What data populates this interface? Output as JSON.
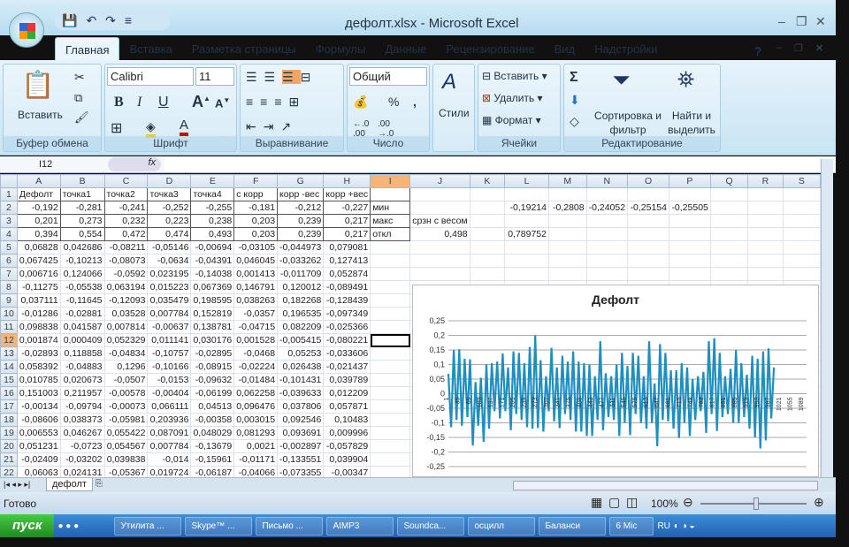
{
  "window": {
    "title": "дефолт.xlsx - Microsoft Excel"
  },
  "tabs": [
    "Главная",
    "Вставка",
    "Разметка страницы",
    "Формулы",
    "Данные",
    "Рецензирование",
    "Вид",
    "Надстройки"
  ],
  "ribbon": {
    "clipboard": {
      "label": "Буфер обмена",
      "paste": "Вставить"
    },
    "font": {
      "label": "Шрифт",
      "name": "Calibri",
      "size": "11",
      "bold": "B",
      "italic": "I",
      "underline": "U"
    },
    "alignment": {
      "label": "Выравнивание"
    },
    "number": {
      "label": "Число",
      "format": "Общий",
      "percent": "%"
    },
    "styles": {
      "label": "Стили"
    },
    "cells": {
      "label": "Ячейки",
      "insert": "Вставить",
      "delete": "Удалить",
      "format": "Формат"
    },
    "editing": {
      "label": "Редактирование",
      "sort": "Сортировка и фильтр",
      "find": "Найти и выделить"
    }
  },
  "formula_bar": {
    "name_box": "I12",
    "fx": "fx",
    "value": ""
  },
  "grid": {
    "columns": [
      "A",
      "B",
      "C",
      "D",
      "E",
      "F",
      "G",
      "H",
      "I",
      "J",
      "K",
      "L",
      "M",
      "N",
      "O",
      "P",
      "Q",
      "R",
      "S"
    ],
    "selected_cell": "I12",
    "rows": [
      [
        "Дефолт",
        "точка1",
        "точка2",
        "точка3",
        "точка4",
        "с корр",
        "корр -вес",
        "корр +вес",
        "",
        "",
        "",
        "",
        "",
        "",
        "",
        "",
        "",
        "",
        ""
      ],
      [
        "-0,192",
        "-0,281",
        "-0,241",
        "-0,252",
        "-0,255",
        "-0,181",
        "-0,212",
        "-0,227",
        "мин",
        "",
        "",
        "-0,19214",
        "-0,2808",
        "-0,24052",
        "-0,25154",
        "-0,25505",
        "",
        "",
        ""
      ],
      [
        "0,201",
        "0,273",
        "0,232",
        "0,223",
        "0,238",
        "0,203",
        "0,239",
        "0,217",
        "макс",
        "срзн с весом",
        "",
        "",
        "",
        "",
        "",
        "",
        "",
        "",
        ""
      ],
      [
        "0,394",
        "0,554",
        "0,472",
        "0,474",
        "0,493",
        "0,203",
        "0,239",
        "0,217",
        "откл",
        "0,498",
        "",
        "0,789752",
        "",
        "",
        "",
        "",
        "",
        "",
        ""
      ],
      [
        "0,06828",
        "0,042686",
        "-0,08211",
        "-0,05146",
        "-0,00694",
        "-0,03105",
        "-0,044973",
        "0,079081"
      ],
      [
        "0,067425",
        "-0,10213",
        "-0,08073",
        "-0,0634",
        "-0,04391",
        "0,046045",
        "-0,033262",
        "0,127413"
      ],
      [
        "0,006716",
        "0,124066",
        "-0,0592",
        "0,023195",
        "-0,14038",
        "0,001413",
        "-0,011709",
        "0,052874"
      ],
      [
        "-0,11275",
        "-0,05538",
        "0,063194",
        "0,015223",
        "0,067369",
        "0,146791",
        "0,120012",
        "-0,089491"
      ],
      [
        "0,037111",
        "-0,11645",
        "-0,12093",
        "0,035479",
        "0,198595",
        "0,038263",
        "0,182268",
        "-0,128439"
      ],
      [
        "-0,01286",
        "-0,02881",
        "0,03528",
        "0,007784",
        "0,152819",
        "-0,0357",
        "0,196535",
        "-0,097349"
      ],
      [
        "0,098838",
        "0,041587",
        "0,007814",
        "-0,00637",
        "0,138781",
        "-0,04715",
        "0,082209",
        "-0,025366"
      ],
      [
        "0,001874",
        "0,000409",
        "0,052329",
        "0,011141",
        "0,030176",
        "0,001528",
        "-0,005415",
        "-0,080221"
      ],
      [
        "-0,02893",
        "0,118858",
        "-0,04834",
        "-0,10757",
        "-0,02895",
        "-0,0468",
        "0,05253",
        "-0,033606"
      ],
      [
        "0,058392",
        "-0,04883",
        "0,1296",
        "-0,10166",
        "-0,08915",
        "-0,02224",
        "0,026438",
        "-0,021437"
      ],
      [
        "0,010785",
        "0,020673",
        "-0,0507",
        "-0,0153",
        "-0,09632",
        "-0,01484",
        "-0,101431",
        "0,039789"
      ],
      [
        "0,151003",
        "0,211957",
        "-0,00578",
        "-0,00404",
        "-0,06199",
        "0,062258",
        "-0,039633",
        "0,012209"
      ],
      [
        "-0,00134",
        "-0,09794",
        "-0,00073",
        "0,066111",
        "0,04513",
        "0,096476",
        "0,037806",
        "0,057871"
      ],
      [
        "-0,08606",
        "0,038373",
        "-0,05981",
        "0,203936",
        "-0,00358",
        "0,003015",
        "0,092546",
        "0,10483"
      ],
      [
        "0,006553",
        "0,046267",
        "0,055422",
        "0,087091",
        "0,048029",
        "0,081293",
        "0,093691",
        "0,009996"
      ],
      [
        "0,051231",
        "-0,0723",
        "0,054567",
        "0,007784",
        "-0,13679",
        "0,0021",
        "-0,002897",
        "-0,057829"
      ],
      [
        "-0,02409",
        "-0,03202",
        "0,039838",
        "-0,014",
        "-0,15961",
        "-0,01171",
        "-0,133551",
        "0,039904"
      ],
      [
        "0,06063",
        "0,024131",
        "-0,05367",
        "0,019724",
        "-0,06187",
        "-0,04066",
        "-0,073355",
        "-0,00347"
      ]
    ]
  },
  "chart_data": {
    "type": "line",
    "title": "Дефолт",
    "color": "#1f8fc0",
    "ylim": [
      -0.25,
      0.25
    ],
    "yticks": [
      "-0,25",
      "-0,2",
      "-0,15",
      "-0,1",
      "-0,05",
      "0",
      "0,05",
      "0,1",
      "0,15",
      "0,2",
      "0,25"
    ],
    "xticks": [
      "1",
      "35",
      "69",
      "103",
      "137",
      "171",
      "205",
      "239",
      "273",
      "307",
      "341",
      "375",
      "409",
      "443",
      "477",
      "511",
      "545",
      "579",
      "613",
      "647",
      "681",
      "715",
      "749",
      "783",
      "817",
      "851",
      "885",
      "919",
      "953",
      "987",
      "1021",
      "1055",
      "1089"
    ],
    "xlim": [
      1,
      1100
    ],
    "grid": true,
    "series": [
      {
        "x_end": 1000,
        "values": [
          0.068,
          -0.115,
          0.15,
          -0.09,
          0.152,
          -0.11,
          0.12,
          -0.08,
          0.118,
          -0.178,
          0.04,
          -0.11,
          0.055,
          -0.165,
          0.1,
          -0.12,
          0.105,
          -0.06,
          0.11,
          -0.085,
          0.138,
          -0.06,
          0.09,
          -0.125,
          0.145,
          -0.07,
          0.14,
          -0.09,
          0.105,
          -0.115,
          0.16,
          -0.12,
          0.2,
          -0.118,
          0.115,
          -0.13,
          0.06,
          -0.06,
          0.157,
          -0.095,
          0.09,
          -0.118,
          0.13,
          -0.07,
          0.11,
          -0.09,
          0.145,
          -0.13,
          0.11,
          -0.13,
          0.105,
          -0.145,
          0.1,
          -0.145,
          0.06,
          -0.09,
          0.18,
          -0.125,
          0.07,
          -0.08,
          0.06,
          -0.09,
          0.1,
          -0.145,
          0.14,
          -0.1,
          0.095,
          -0.142,
          0.14,
          -0.07,
          0.13,
          -0.1,
          0.06,
          -0.12,
          0.18,
          -0.1,
          0.035,
          -0.18,
          0.17,
          -0.09,
          0.14,
          -0.095,
          0.08,
          -0.12,
          0.08,
          -0.152,
          0.105,
          -0.1,
          0.09,
          -0.145,
          0.05,
          -0.09,
          0.06,
          -0.06,
          0.075,
          -0.135,
          0.18,
          -0.07,
          0.19,
          -0.128,
          0.14,
          -0.08,
          0.06,
          -0.07,
          0.085,
          -0.1,
          0.15,
          -0.1,
          0.105,
          -0.08,
          0.065,
          -0.12,
          0.13,
          -0.15,
          0.12,
          -0.188,
          0.145,
          -0.16,
          0.155,
          -0.085,
          0.09
        ]
      }
    ]
  },
  "sheet_tabs": [
    "дефолт"
  ],
  "status": {
    "text": "Готово",
    "zoom": "100%"
  },
  "taskbar": {
    "start": "пуск",
    "items": [
      "Утилита ...",
      "Skype™ ...",
      "Письмо ...",
      "AIMP3",
      "Soundca...",
      "осцилл",
      "Баланси",
      "6 Mic"
    ],
    "lang": "RU"
  }
}
